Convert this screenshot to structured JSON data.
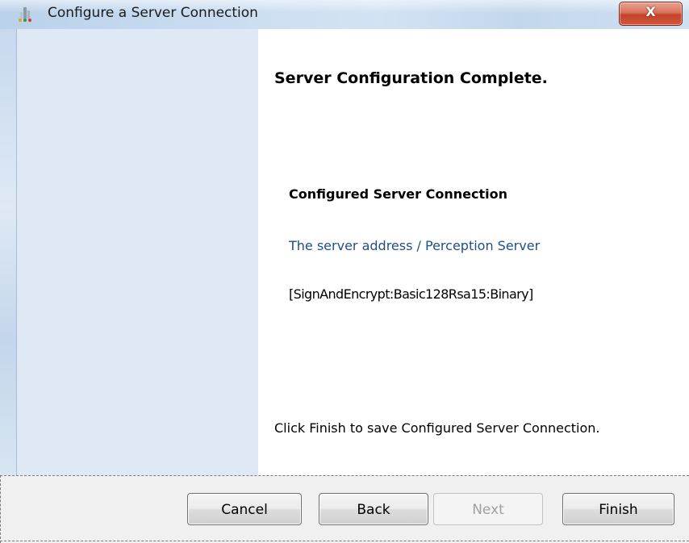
{
  "window": {
    "title": "Configure a Server Connection",
    "icon": "app-icon",
    "close_glyph": "X"
  },
  "page": {
    "heading": "Server Configuration Complete.",
    "section_title": "Configured Server Connection",
    "server_text": "The server address / Perception Server",
    "security_text": "[SignAndEncrypt:Basic128Rsa15:Binary]",
    "finish_note": "Click Finish to save Configured Server Connection."
  },
  "buttons": {
    "cancel": "Cancel",
    "back": "Back",
    "next": "Next",
    "finish": "Finish"
  },
  "colors": {
    "sidepanel": "#dfe8f5",
    "link_text": "#1f4f8a",
    "close_button": "#c4432b"
  }
}
